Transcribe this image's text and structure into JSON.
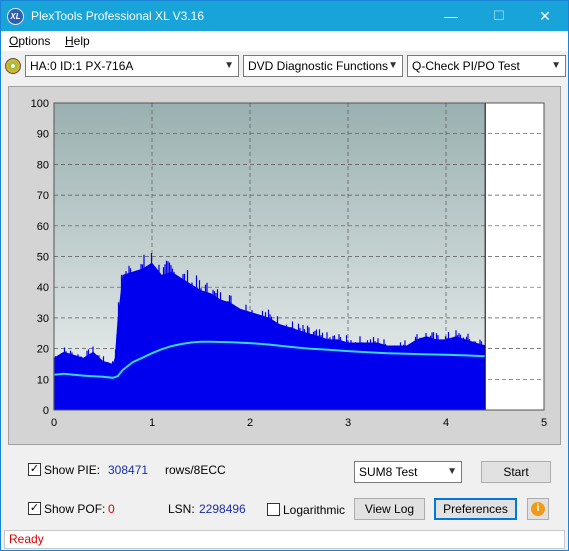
{
  "window": {
    "title": "PlexTools Professional XL V3.16",
    "app_icon_text": "XL",
    "minimize": "—",
    "maximize": "☐",
    "close": "✕"
  },
  "menu": {
    "options": "ptions",
    "options_mnemonic": "O",
    "help": "elp",
    "help_mnemonic": "H"
  },
  "toolbar": {
    "drive_select": "HA:0 ID:1  PX-716A",
    "function_select": "DVD Diagnostic Functions",
    "test_select": "Q-Check PI/PO Test"
  },
  "chart_data": {
    "type": "area",
    "title": "",
    "xlabel": "",
    "ylabel": "",
    "xlim": [
      0,
      5
    ],
    "ylim": [
      0,
      100
    ],
    "x_ticks": [
      "0",
      "1",
      "2",
      "3",
      "4",
      "5"
    ],
    "y_ticks": [
      "0",
      "10",
      "20",
      "30",
      "40",
      "50",
      "60",
      "70",
      "80",
      "90",
      "100"
    ],
    "grid": true,
    "data_end_x": 4.4,
    "colors": {
      "pie_fill": "#0000ee",
      "trend_line": "#35d6e6",
      "background_top": "#9ab0b0",
      "background_bottom": "#f0f2f2"
    },
    "series": [
      {
        "type": "area",
        "x": [
          0.0,
          0.1,
          0.2,
          0.3,
          0.4,
          0.5,
          0.6,
          0.62,
          0.65,
          0.7,
          0.8,
          0.9,
          1.0,
          1.1,
          1.2,
          1.3,
          1.4,
          1.5,
          1.6,
          1.7,
          1.8,
          1.9,
          2.0,
          2.1,
          2.2,
          2.3,
          2.4,
          2.5,
          2.6,
          2.7,
          2.8,
          2.9,
          3.0,
          3.1,
          3.2,
          3.3,
          3.4,
          3.5,
          3.6,
          3.7,
          3.8,
          3.9,
          4.0,
          4.1,
          4.2,
          4.3,
          4.4
        ],
        "values": [
          17,
          19,
          18,
          17,
          19,
          16,
          15,
          17,
          30,
          44,
          45,
          46,
          48,
          44,
          45,
          43,
          41,
          39,
          38,
          36,
          35,
          33,
          32,
          31,
          30,
          28,
          27,
          26,
          25,
          24,
          23,
          23,
          22,
          22,
          22,
          22,
          21,
          21,
          21,
          23,
          24,
          23,
          23,
          24,
          23,
          22,
          21
        ]
      },
      {
        "type": "line",
        "x": [
          0.0,
          0.1,
          0.2,
          0.3,
          0.4,
          0.5,
          0.6,
          0.65,
          0.7,
          0.8,
          0.9,
          1.0,
          1.1,
          1.2,
          1.3,
          1.4,
          1.5,
          1.6,
          1.8,
          2.0,
          2.2,
          2.4,
          2.6,
          2.8,
          3.0,
          3.2,
          3.4,
          3.6,
          3.8,
          4.0,
          4.2,
          4.4
        ],
        "values": [
          11.5,
          11.8,
          11.5,
          11.2,
          11.0,
          10.8,
          10.5,
          11.0,
          13.0,
          15.5,
          17.0,
          18.5,
          19.8,
          20.8,
          21.5,
          22.0,
          22.2,
          22.2,
          22.1,
          21.8,
          21.3,
          20.6,
          20.0,
          19.6,
          19.2,
          18.8,
          18.5,
          18.3,
          18.1,
          18.0,
          17.8,
          17.5
        ]
      }
    ]
  },
  "controls": {
    "show_pie_label": "Show PIE:",
    "show_pie_checked": "✓",
    "pie_value": "308471",
    "pie_unit": "rows/8ECC",
    "show_pof_label": "Show POF:",
    "show_pof_checked": "✓",
    "pof_value": "0",
    "lsn_label": "LSN:",
    "lsn_value": "2298496",
    "logarithmic_label": "Logarithmic",
    "sum_select": "SUM8 Test",
    "start_button": "Start",
    "view_log_button": "View Log",
    "preferences_button": "Preferences",
    "info_icon": "i"
  },
  "status": {
    "text": "Ready"
  }
}
